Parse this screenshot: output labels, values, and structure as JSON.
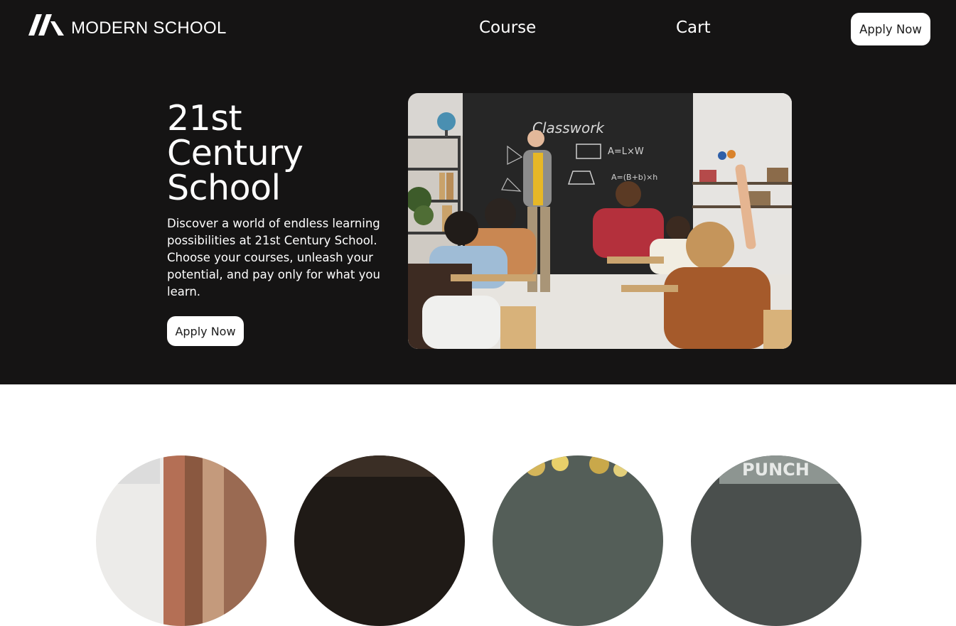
{
  "header": {
    "brand": "MODERN SCHOOL",
    "logo_icon": "modern-school-logo",
    "nav": [
      {
        "label": "Course"
      },
      {
        "label": "Cart"
      }
    ],
    "apply_label": "Apply Now"
  },
  "hero": {
    "title_lines": [
      "21st",
      "Century",
      "School"
    ],
    "description": "Discover a world of endless learning possibilities at 21st Century School. Choose your courses, unleash your potential, and pay only for what you learn.",
    "apply_label": "Apply Now",
    "image": {
      "board_heading": "Classwork",
      "board_formula_1": "A=L×W",
      "board_formula_2": "A=(B+b)×h"
    }
  },
  "cards": {
    "card_4_sign": "PUNCH"
  },
  "colors": {
    "hero_bg": "#151414",
    "button_bg": "#ffffff",
    "text_light": "#ffffff",
    "text_dark": "#1b1b1b"
  }
}
